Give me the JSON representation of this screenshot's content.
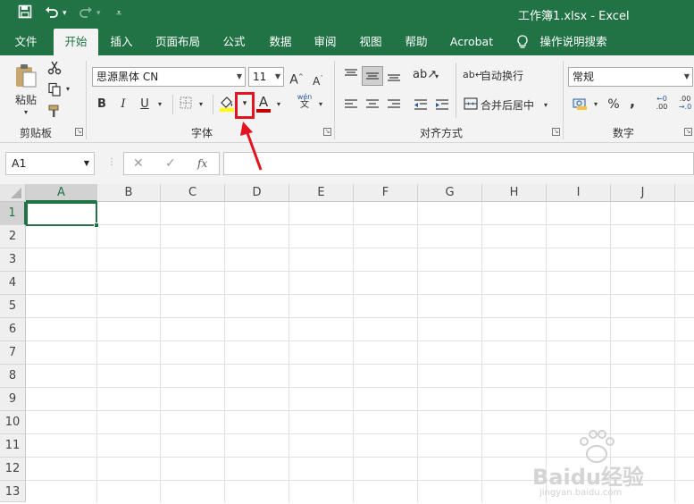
{
  "window": {
    "title": "工作簿1.xlsx  -  Excel"
  },
  "quick_access": {
    "save_icon": "save-icon",
    "undo_icon": "undo-icon",
    "redo_icon": "redo-icon",
    "customize_icon": "customize-qat-icon"
  },
  "tabs": [
    "文件",
    "开始",
    "插入",
    "页面布局",
    "公式",
    "数据",
    "审阅",
    "视图",
    "帮助",
    "Acrobat",
    "操作说明搜索"
  ],
  "active_tab": "开始",
  "ribbon": {
    "clipboard": {
      "label": "剪贴板",
      "paste": "粘贴"
    },
    "font": {
      "label": "字体",
      "font_name": "思源黑体 CN",
      "font_size": "11",
      "bold": "B",
      "italic": "I",
      "underline": "U",
      "grow": "A",
      "shrink": "A",
      "font_color": "A",
      "phonetic_top": "wén",
      "phonetic_bottom": "文"
    },
    "alignment": {
      "label": "对齐方式",
      "wrap_text": "自动换行",
      "merge_center": "合并后居中"
    },
    "number": {
      "label": "数字",
      "format": "常规",
      "percent": "%",
      "comma": ",",
      "inc_decimal_top": "←0",
      "inc_decimal_bottom": ".00",
      "dec_decimal_top": ".00",
      "dec_decimal_bottom": "→.0"
    }
  },
  "formula_bar": {
    "name_box": "A1",
    "cancel": "✕",
    "enter": "✓",
    "fx": "fx",
    "formula": ""
  },
  "columns": [
    "A",
    "B",
    "C",
    "D",
    "E",
    "F",
    "G",
    "H",
    "I",
    "J"
  ],
  "rows": [
    "1",
    "2",
    "3",
    "4",
    "5",
    "6",
    "7",
    "8",
    "9",
    "10",
    "11",
    "12",
    "13"
  ],
  "active_cell": "A1",
  "watermark": {
    "text": "Baidu经验",
    "url": "jingyan.baidu.com"
  },
  "colors": {
    "excel_green": "#217346",
    "ribbon_bg": "#f3f3f3",
    "highlight_red": "#e3141f",
    "fill_yellow": "#ffff00",
    "font_red": "#c00000"
  }
}
